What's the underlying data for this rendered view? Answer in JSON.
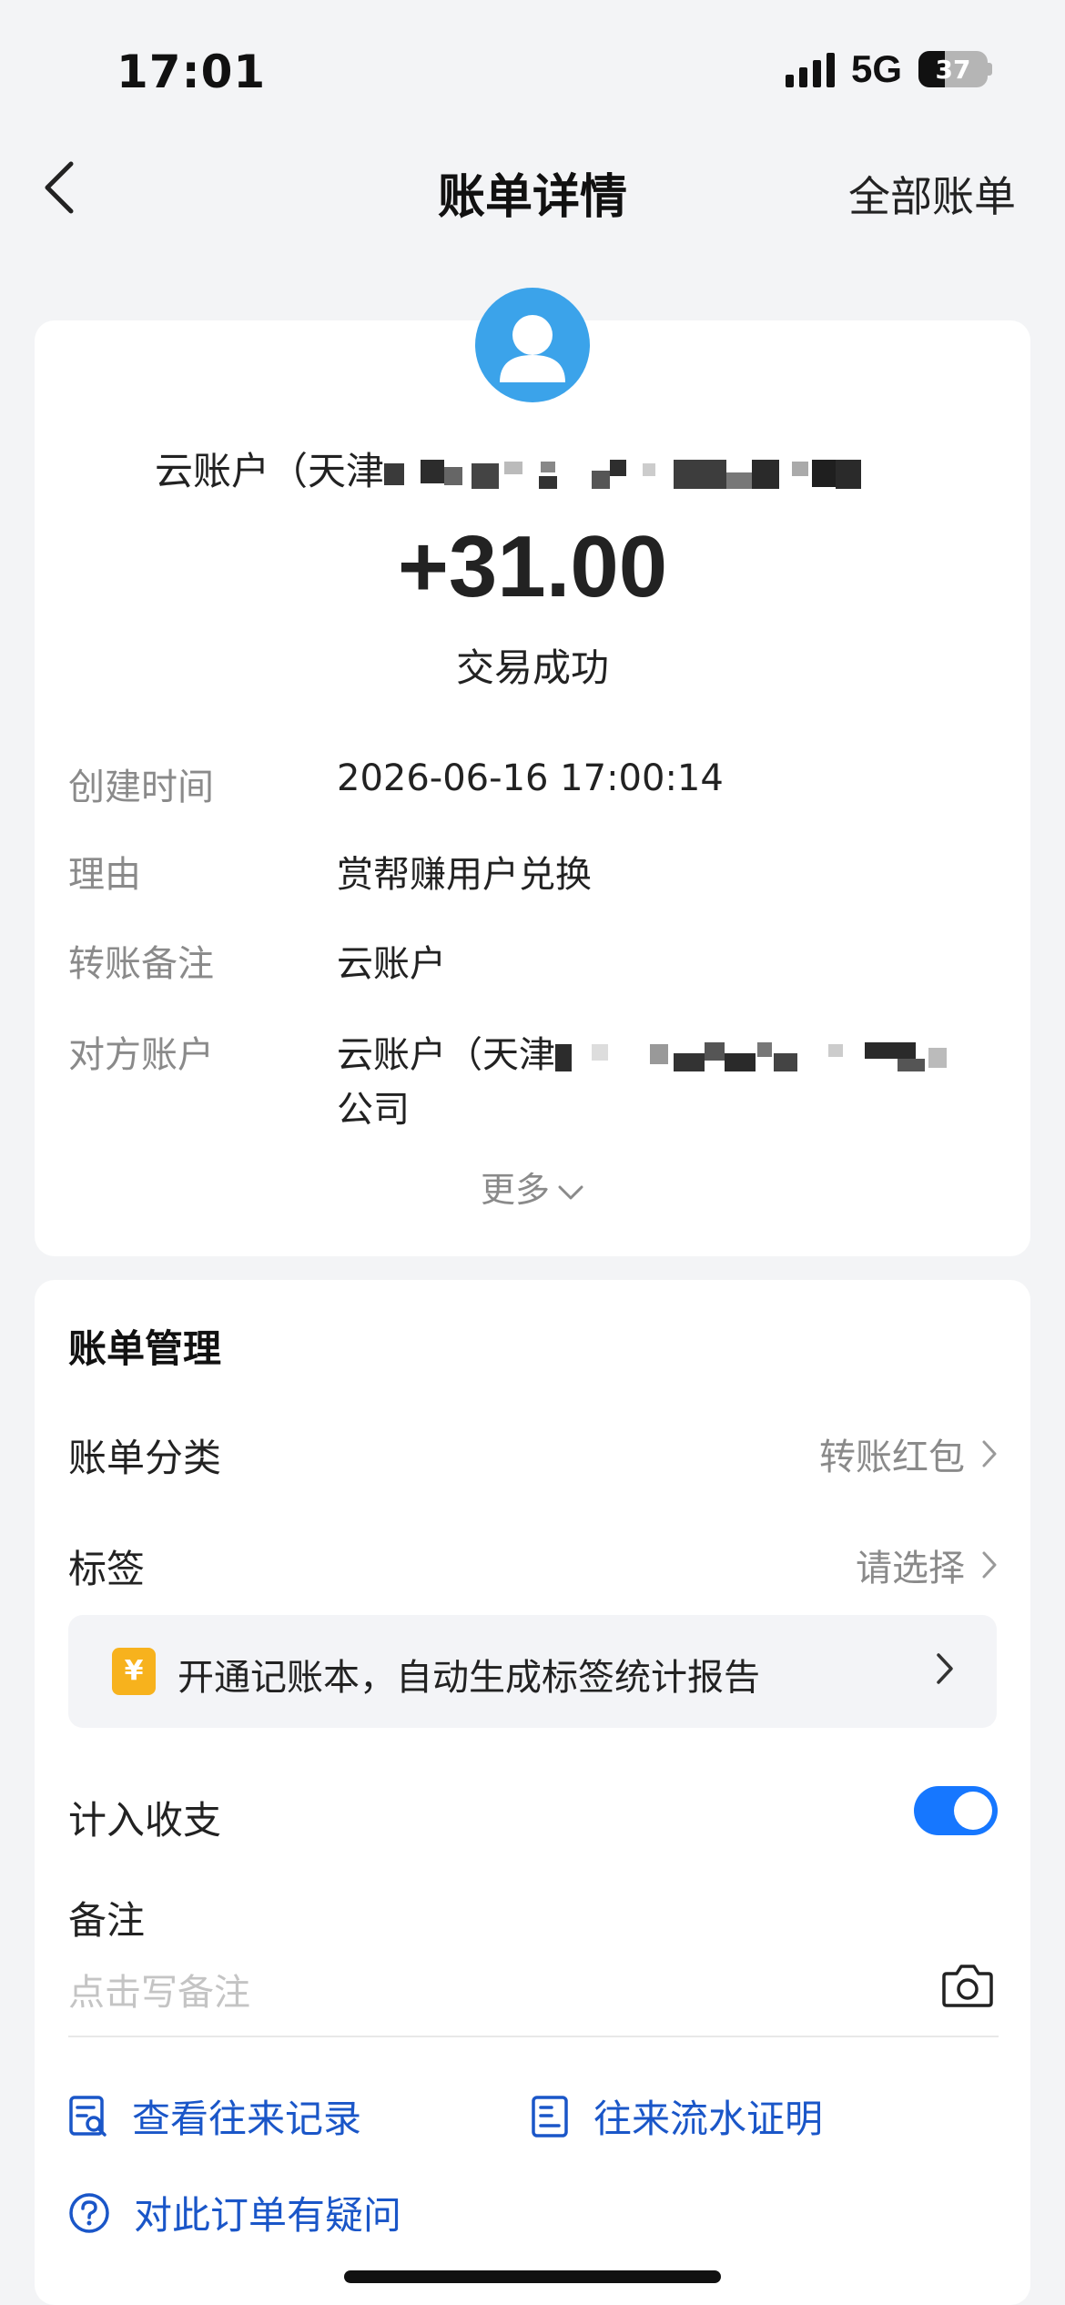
{
  "status_bar": {
    "time": "17:01",
    "network": "5G",
    "battery": "37"
  },
  "nav": {
    "title": "账单详情",
    "right_link": "全部账单"
  },
  "transaction": {
    "payee": "云账户（天津",
    "amount": "+31.00",
    "status": "交易成功",
    "details": [
      {
        "label": "创建时间",
        "value": "2026-06-16 17:00:14"
      },
      {
        "label": "理由",
        "value": "赏帮赚用户兑换"
      },
      {
        "label": "转账备注",
        "value": "云账户"
      },
      {
        "label": "对方账户",
        "value": "云账户（天津",
        "value_line2": "公司"
      }
    ],
    "more": "更多"
  },
  "management": {
    "title": "账单管理",
    "category": {
      "label": "账单分类",
      "value": "转账红包"
    },
    "tag": {
      "label": "标签",
      "value": "请选择"
    },
    "promo": {
      "icon": "¥",
      "text": "开通记账本，自动生成标签统计报告"
    },
    "include_in_stats": {
      "label": "计入收支",
      "enabled": true
    },
    "note": {
      "label": "备注",
      "placeholder": "点击写备注"
    },
    "links": {
      "history": "查看往来记录",
      "proof": "往来流水证明",
      "question": "对此订单有疑问"
    }
  },
  "colors": {
    "accent_blue": "#1677ff",
    "link_blue": "#1a56c8",
    "avatar_blue": "#3ba3ea",
    "promo_yellow": "#f7b21d"
  }
}
